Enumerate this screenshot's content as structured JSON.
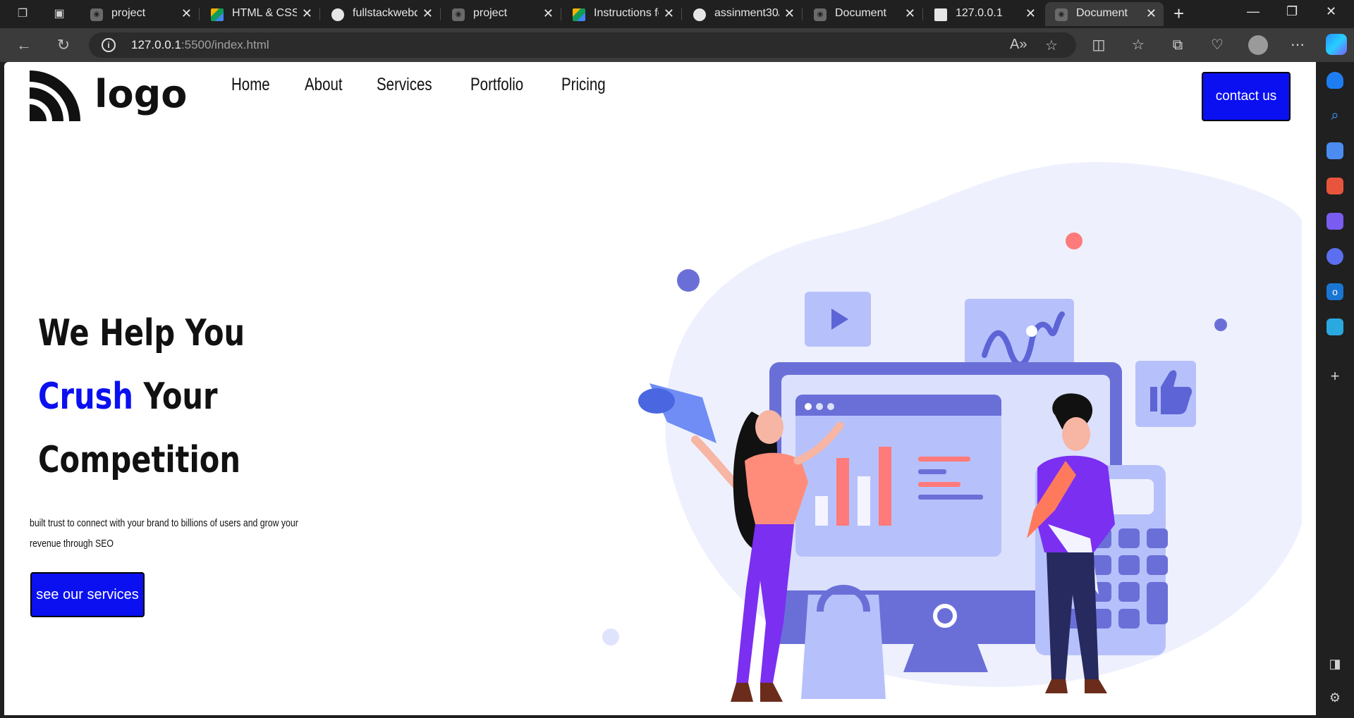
{
  "browser": {
    "tabs": [
      {
        "title": "project",
        "icon": "broadcast-icon",
        "active": false
      },
      {
        "title": "HTML & CSS",
        "icon": "google-drive-icon",
        "active": false
      },
      {
        "title": "fullstackwebd",
        "icon": "github-icon",
        "active": false
      },
      {
        "title": "project",
        "icon": "broadcast-icon",
        "active": false
      },
      {
        "title": "Instructions fo",
        "icon": "google-drive-icon",
        "active": false
      },
      {
        "title": "assinment30/",
        "icon": "github-icon",
        "active": false
      },
      {
        "title": "Document",
        "icon": "broadcast-icon",
        "active": false
      },
      {
        "title": "127.0.0.1",
        "icon": "document-icon",
        "active": false
      },
      {
        "title": "Document",
        "icon": "broadcast-icon",
        "active": true
      }
    ],
    "url_host": "127.0.0.1",
    "url_rest": ":5500/index.html"
  },
  "page": {
    "logo_text": "logo",
    "nav": [
      "Home",
      "About",
      "Services",
      "Portfolio",
      "Pricing"
    ],
    "contact_label": "contact us",
    "headline": {
      "line1": "We Help You",
      "accent": "Crush",
      "line2_rest": " Your",
      "line3": "Competition"
    },
    "subtext": "built trust to connect with your brand to billions of users and grow your revenue through SEO",
    "cta_label": "see our services",
    "accent_color": "#0a10f0"
  }
}
